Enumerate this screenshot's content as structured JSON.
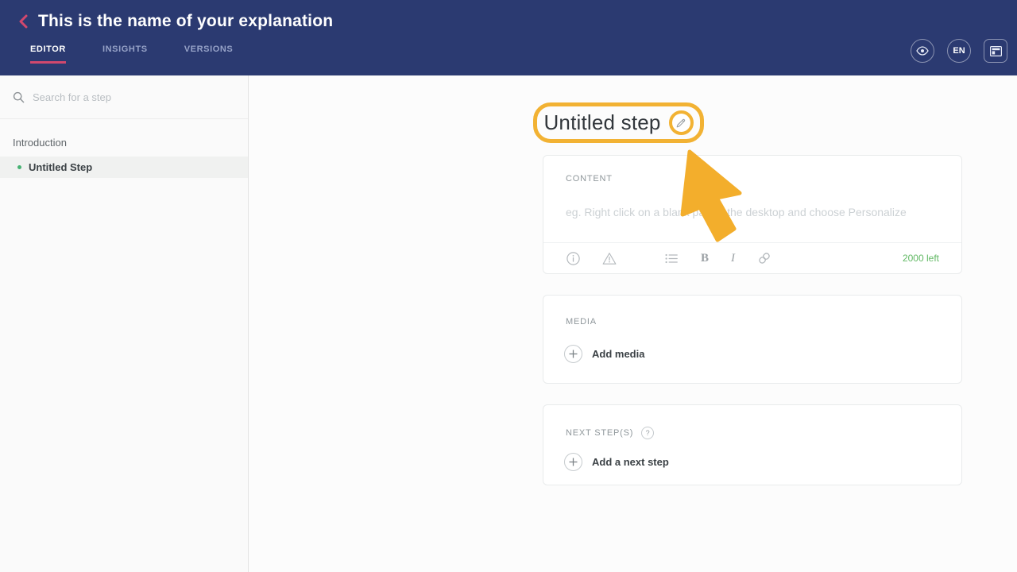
{
  "header": {
    "title": "This is the name of your explanation",
    "tabs": [
      {
        "label": "EDITOR",
        "active": true
      },
      {
        "label": "INSIGHTS",
        "active": false
      },
      {
        "label": "VERSIONS",
        "active": false
      }
    ],
    "language_badge": "EN",
    "icons": {
      "back": "chevron-left",
      "preview": "eye",
      "layout": "window-layout"
    }
  },
  "sidebar": {
    "search_placeholder": "Search for a step",
    "section_label": "Introduction",
    "steps": [
      {
        "label": "Untitled Step",
        "active": true
      }
    ]
  },
  "main": {
    "step_title": "Untitled step",
    "content_card": {
      "label": "CONTENT",
      "placeholder": "eg. Right click on a blank part of the desktop and choose Personalize",
      "toolbar_icons": [
        "info",
        "warning",
        "bullet-list",
        "bold",
        "italic",
        "link"
      ],
      "bold_label": "B",
      "italic_label": "I",
      "chars_left": "2000 left"
    },
    "media_card": {
      "label": "MEDIA",
      "add_label": "Add media"
    },
    "next_card": {
      "label": "NEXT STEP(S)",
      "help_icon": "question-circle",
      "add_label": "Add a next step"
    },
    "annotation": {
      "highlight_shape": "rounded-rect-around-step-title",
      "cursor_arrow": "large-yellow-arrow-pointing-at-title"
    }
  },
  "colors": {
    "header_bg": "#2b3a71",
    "accent_pink": "#d2486e",
    "highlight_yellow": "#f2b233",
    "arrow_yellow": "#f3ae2c",
    "success_green": "#62b965",
    "step_dot_green": "#47b273"
  }
}
